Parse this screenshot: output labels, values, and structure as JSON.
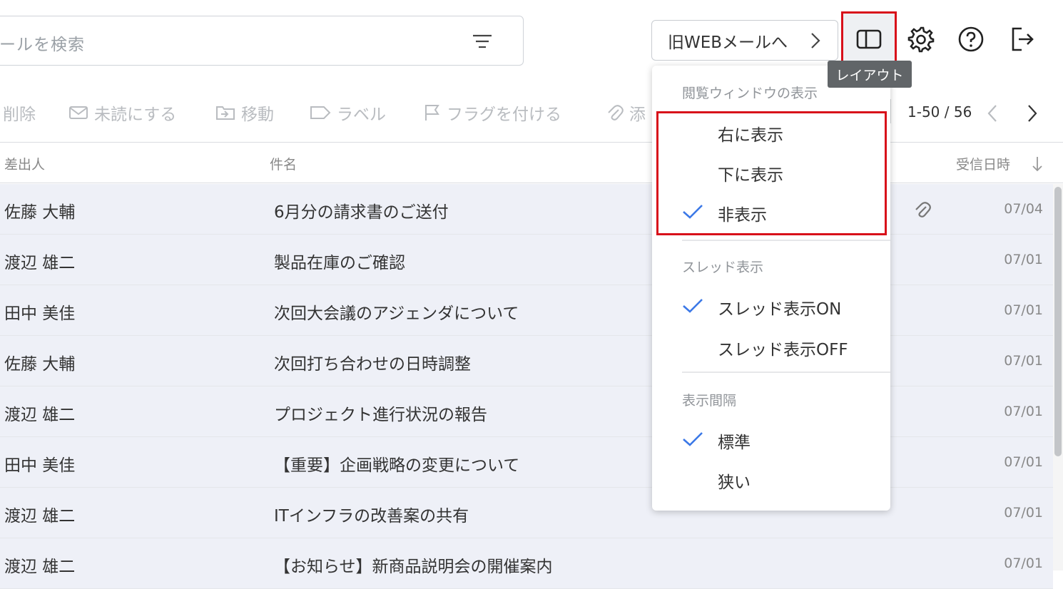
{
  "search": {
    "placeholder": "ールを検索",
    "filter_icon": "filter-icon"
  },
  "header": {
    "old_web_label": "旧WEBメールへ",
    "layout_tooltip": "レイアウト",
    "icons": [
      "layout-icon",
      "gear-icon",
      "help-icon",
      "logout-icon"
    ]
  },
  "toolbar": {
    "delete": "削除",
    "mark_unread": "未読にする",
    "move": "移動",
    "label": "ラベル",
    "flag": "フラグを付ける",
    "attach": "添",
    "pager": "1-50 / 56"
  },
  "list": {
    "col_from": "差出人",
    "col_subject": "件名",
    "col_date": "受信日時",
    "rows": [
      {
        "from": "佐藤 大輔",
        "subject": "6月分の請求書のご送付",
        "date": "07/04",
        "attachment": true
      },
      {
        "from": "渡辺 雄二",
        "subject": "製品在庫のご確認",
        "date": "07/01"
      },
      {
        "from": "田中 美佳",
        "subject": "次回大会議のアジェンダについて",
        "date": "07/01"
      },
      {
        "from": "佐藤 大輔",
        "subject": "次回打ち合わせの日時調整",
        "date": "07/01"
      },
      {
        "from": "渡辺 雄二",
        "subject": "プロジェクト進行状況の報告",
        "date": "07/01"
      },
      {
        "from": "田中 美佳",
        "subject": "【重要】企画戦略の変更について",
        "date": "07/01"
      },
      {
        "from": "渡辺 雄二",
        "subject": "ITインフラの改善案の共有",
        "date": "07/01"
      },
      {
        "from": "渡辺 雄二",
        "subject": "【お知らせ】新商品説明会の開催案内",
        "date": "07/01"
      }
    ]
  },
  "layout_menu": {
    "reading_pane_heading": "閲覧ウィンドウの表示",
    "reading_pane": [
      {
        "label": "右に表示",
        "checked": false
      },
      {
        "label": "下に表示",
        "checked": false
      },
      {
        "label": "非表示",
        "checked": true
      }
    ],
    "thread_heading": "スレッド表示",
    "thread": [
      {
        "label": "スレッド表示ON",
        "checked": true
      },
      {
        "label": "スレッド表示OFF",
        "checked": false
      }
    ],
    "spacing_heading": "表示間隔",
    "spacing": [
      {
        "label": "標準",
        "checked": true
      },
      {
        "label": "狭い",
        "checked": false
      }
    ]
  },
  "colors": {
    "accent": "#3b78e7",
    "highlight_red": "#d8101a",
    "row_bg": "#eef0f7"
  }
}
